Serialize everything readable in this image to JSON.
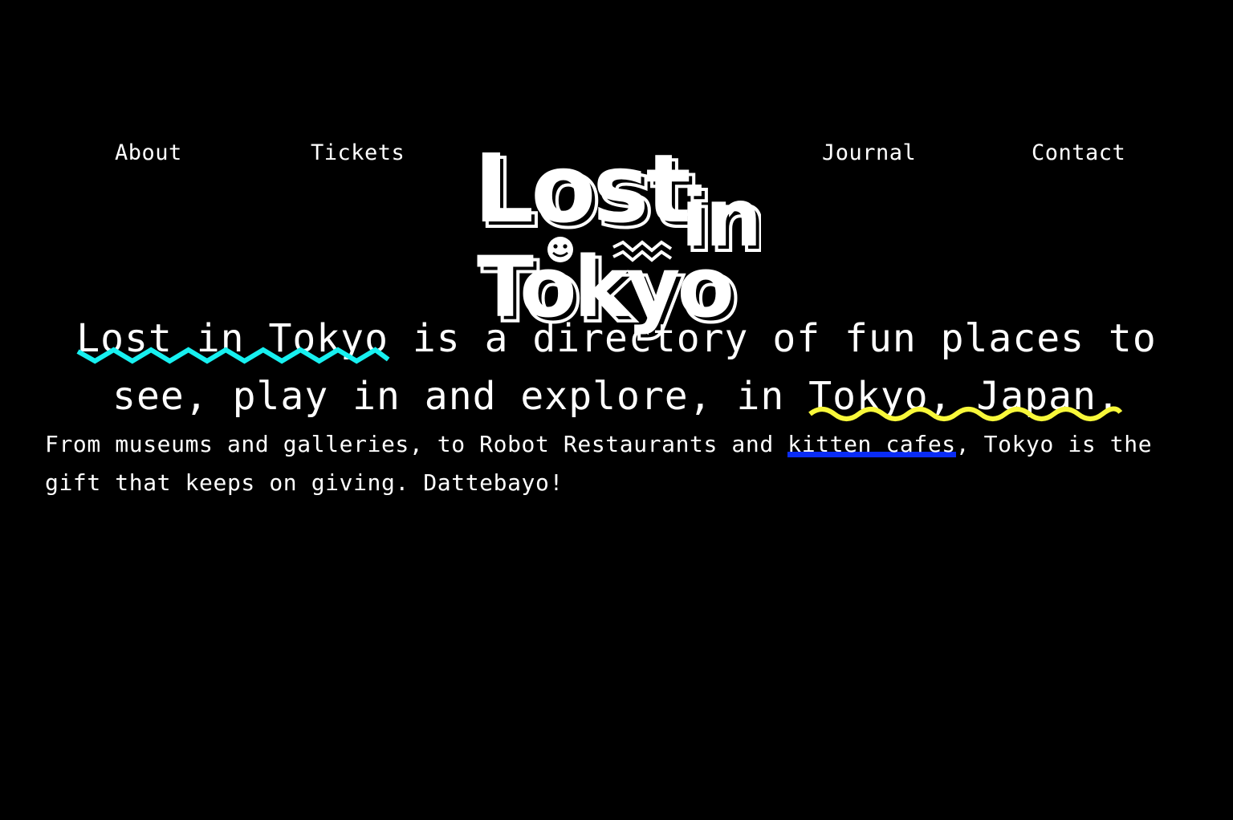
{
  "nav": {
    "about_label": "About",
    "tickets_label": "Tickets",
    "journal_label": "Journal",
    "contact_label": "Contact"
  },
  "logo": {
    "word_lost": "Lost",
    "word_in": "in",
    "word_tokyo": "Tokyo"
  },
  "headline": {
    "link_1": "Lost in Tokyo",
    "text_1": " is a directory of fun places to see, play in and explore, in ",
    "link_2": "Tokyo, Japan.",
    "link_1_color": "#17f0f0",
    "link_2_color": "#f8f83a"
  },
  "intro": {
    "text_1": "From museums and galleries, to Robot Restaurants and ",
    "link": "kitten cafes",
    "text_2": ", Tokyo is the gift that keeps on giving. Dattebayo!",
    "highlight_color": "#0a2cf5"
  }
}
